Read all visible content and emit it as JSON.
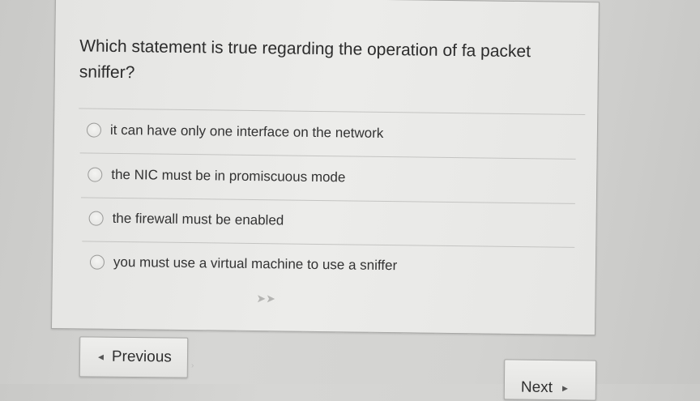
{
  "question": {
    "text": "Which statement is true regarding the operation of fa packet sniffer?"
  },
  "options": [
    {
      "label": "it can have only one interface on the network",
      "selected": false
    },
    {
      "label": "the NIC must be in promiscuous mode",
      "selected": false
    },
    {
      "label": "the firewall must be enabled",
      "selected": false
    },
    {
      "label": "you must use a virtual machine to use a sniffer",
      "selected": false
    }
  ],
  "navigation": {
    "previous_label": "Previous",
    "next_label": "Next"
  },
  "icons": {
    "previous": "chevron-left-icon",
    "next": "chevron-right-icon",
    "cursor": "mouse-cursor-icon"
  }
}
